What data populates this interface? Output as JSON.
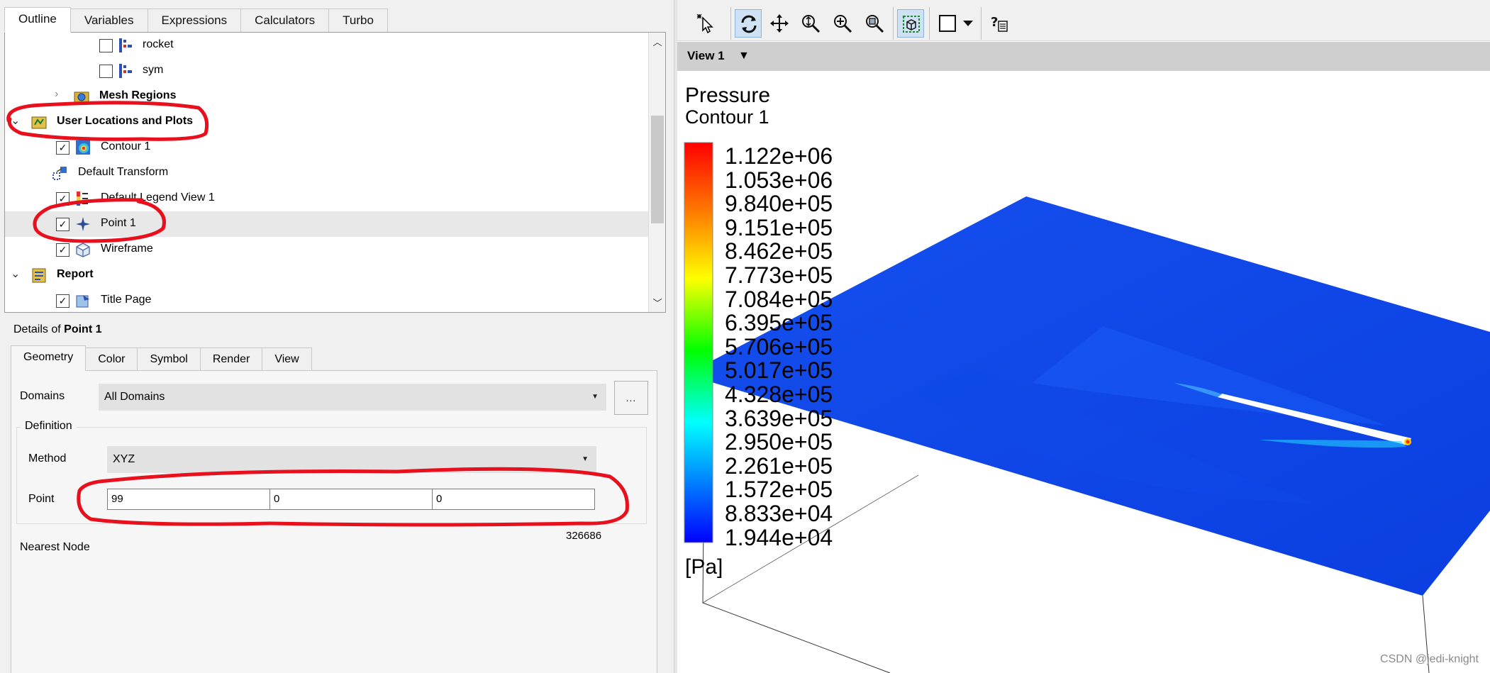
{
  "outline_tabs": [
    {
      "label": "Outline"
    },
    {
      "label": "Variables"
    },
    {
      "label": "Expressions"
    },
    {
      "label": "Calculators"
    },
    {
      "label": "Turbo"
    }
  ],
  "tree": {
    "items": [
      {
        "label": "rocket",
        "checked": false,
        "icon": "boundary-icon"
      },
      {
        "label": "sym",
        "checked": false,
        "icon": "boundary-icon"
      },
      {
        "label": "Mesh Regions",
        "icon": "mesh-regions-icon"
      },
      {
        "label": "User Locations and Plots",
        "icon": "user-locations-icon"
      },
      {
        "label": "Contour 1",
        "checked": true,
        "icon": "contour-icon"
      },
      {
        "label": "Default Transform",
        "icon": "transform-icon"
      },
      {
        "label": "Default Legend View 1",
        "checked": true,
        "icon": "legend-icon"
      },
      {
        "label": "Point 1",
        "checked": true,
        "icon": "point-icon"
      },
      {
        "label": "Wireframe",
        "checked": true,
        "icon": "wireframe-icon"
      },
      {
        "label": "Report",
        "icon": "report-icon"
      },
      {
        "label": "Title Page",
        "checked": true,
        "icon": "title-page-icon"
      }
    ]
  },
  "details": {
    "prefix": "Details of",
    "object": "Point 1",
    "tabs": [
      {
        "label": "Geometry"
      },
      {
        "label": "Color"
      },
      {
        "label": "Symbol"
      },
      {
        "label": "Render"
      },
      {
        "label": "View"
      }
    ],
    "domains_label": "Domains",
    "domains_value": "All Domains",
    "ellipsis": "...",
    "definition_title": "Definition",
    "method_label": "Method",
    "method_value": "XYZ",
    "point_label": "Point",
    "point_x": "99",
    "point_y": "0",
    "point_z": "0",
    "nearest_node_label": "Nearest Node",
    "nearest_node_value": "326686"
  },
  "toolbar_icons": [
    "select-icon",
    "rotate-icon",
    "pan-icon",
    "zoom-icon",
    "zoom-box-icon",
    "zoom-fit-icon",
    "highlight-icon",
    "viewport-layout-icon",
    "dropdown-icon",
    "help-icon"
  ],
  "view": {
    "label": "View 1"
  },
  "legend": {
    "variable": "Pressure",
    "plot_name": "Contour 1",
    "unit": "[Pa]",
    "ticks": [
      "1.122e+06",
      "1.053e+06",
      "9.840e+05",
      "9.151e+05",
      "8.462e+05",
      "7.773e+05",
      "7.084e+05",
      "6.395e+05",
      "5.706e+05",
      "5.017e+05",
      "4.328e+05",
      "3.639e+05",
      "2.950e+05",
      "2.261e+05",
      "1.572e+05",
      "8.833e+04",
      "1.944e+04"
    ],
    "colormap": [
      "#ff0000",
      "#ff8000",
      "#ffff00",
      "#00ff00",
      "#00ffff",
      "#0080ff",
      "#0000ff"
    ]
  },
  "colors": {
    "annotation_red": "#e8101c",
    "plate_blue": "#0a3ee8"
  },
  "watermark": "CSDN @jedi-knight"
}
